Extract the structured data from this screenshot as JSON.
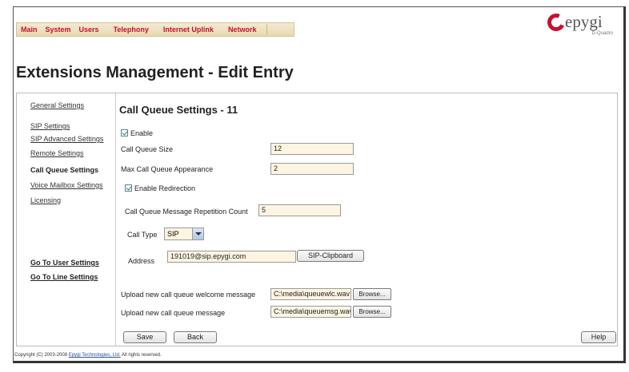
{
  "nav": [
    "Main",
    "System",
    "Users",
    "Telephony",
    "Internet Uplink",
    "Network"
  ],
  "logo": {
    "text": "epygi",
    "sub": "D-Quadro",
    "brand_color": "#c8102e"
  },
  "page_title": "Extensions Management - Edit Entry",
  "sidebar": {
    "items": [
      "General Settings",
      "SIP Settings",
      "SIP Advanced Settings",
      "Remote Settings",
      "Call Queue Settings",
      "Voice Mailbox Settings",
      "Licensing"
    ],
    "active": "Call Queue Settings",
    "bottom_links": [
      "Go To User Settings",
      "Go To Line Settings"
    ]
  },
  "section_title": "Call Queue Settings - 11",
  "form": {
    "enable_label": "Enable",
    "queue_size_label": "Call Queue Size",
    "queue_size_value": "12",
    "max_appearance_label": "Max Call Queue Appearance",
    "max_appearance_value": "2",
    "enable_redirection_label": "Enable Redirection",
    "repetition_label": "Call Queue Message Repetition Count",
    "repetition_value": "5",
    "call_type_label": "Call Type",
    "call_type_value": "SIP",
    "address_label": "Address",
    "address_value": "191019@sip.epygi.com",
    "sip_clipboard_label": "SIP-Clipboard",
    "welcome_label": "Upload new call queue welcome message",
    "welcome_value": "C:\\media\\queuewlc.wav",
    "message_label": "Upload new call queue message",
    "message_value": "C:\\media\\queuemsg.wav",
    "browse_label": "Browse..."
  },
  "buttons": {
    "save": "Save",
    "back": "Back",
    "help": "Help"
  },
  "footer": {
    "prefix": "Copyright (C) 2003-2008",
    "link": "Epygi Technologies, Ltd.",
    "suffix": "All rights reserved."
  }
}
